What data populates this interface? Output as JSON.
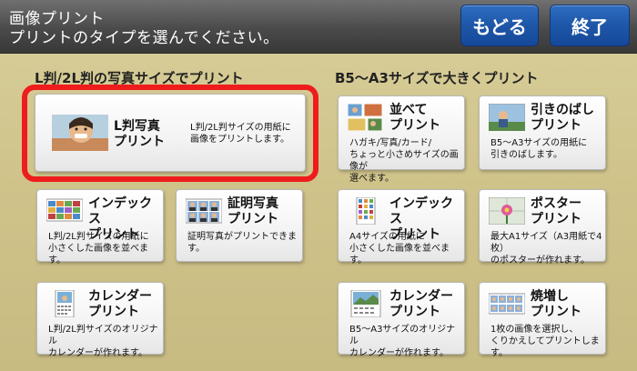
{
  "header": {
    "title_line1": "画像プリント",
    "title_line2": "プリントのタイプを選んでください。",
    "back_label": "もどる",
    "end_label": "終了"
  },
  "sections": {
    "left_label": "L判/2L判の写真サイズでプリント",
    "right_label": "B5～A3サイズで大きくプリント"
  },
  "cards": {
    "l_photo": {
      "name": "L判写真\nプリント",
      "desc": "L判/2L判サイズの用紙に\n画像をプリントします。",
      "icon": "child-photo-icon"
    },
    "index_l": {
      "name": "インデックス\nプリント",
      "desc": "L判/2L判サイズの用紙に\n小さくした画像を並べます。",
      "icon": "index-thumbnails-icon"
    },
    "id_photo": {
      "name": "証明写真\nプリント",
      "desc": "証明写真がプリントできます。",
      "icon": "id-photo-icon"
    },
    "calendar_l": {
      "name": "カレンダー\nプリント",
      "desc": "L判/2L判サイズのオリジナル\nカレンダーが作れます。",
      "icon": "calendar-icon"
    },
    "narabete": {
      "name": "並べて\nプリント",
      "desc": "ハガキ/写真/カード/\nちょっと小さめサイズの画像が\n選べます。",
      "icon": "layout-photos-icon"
    },
    "hikinobashi": {
      "name": "引きのばし\nプリント",
      "desc": "B5～A3サイズの用紙に\n引きのばします。",
      "icon": "enlarge-photo-icon"
    },
    "index_r": {
      "name": "インデックス\nプリント",
      "desc": "A4サイズの用紙に\n小さくした画像を並べます。",
      "icon": "index-sheet-icon"
    },
    "poster": {
      "name": "ポスター\nプリント",
      "desc": "最大A1サイズ（A3用紙で4枚）\nのポスターが作れます。",
      "icon": "poster-flower-icon"
    },
    "calendar_r": {
      "name": "カレンダー\nプリント",
      "desc": "B5～A3サイズのオリジナル\nカレンダーが作れます。",
      "icon": "calendar-icon"
    },
    "yakimashi": {
      "name": "焼増し\nプリント",
      "desc": "1枚の画像を選択し、\nくりかえしてプリントします。",
      "icon": "reprint-copies-icon"
    }
  },
  "colors": {
    "highlight": "#ee1c1c",
    "button_blue": "#1e57a8",
    "header_dark": "#4a4a4a",
    "background": "#cfc38a"
  }
}
